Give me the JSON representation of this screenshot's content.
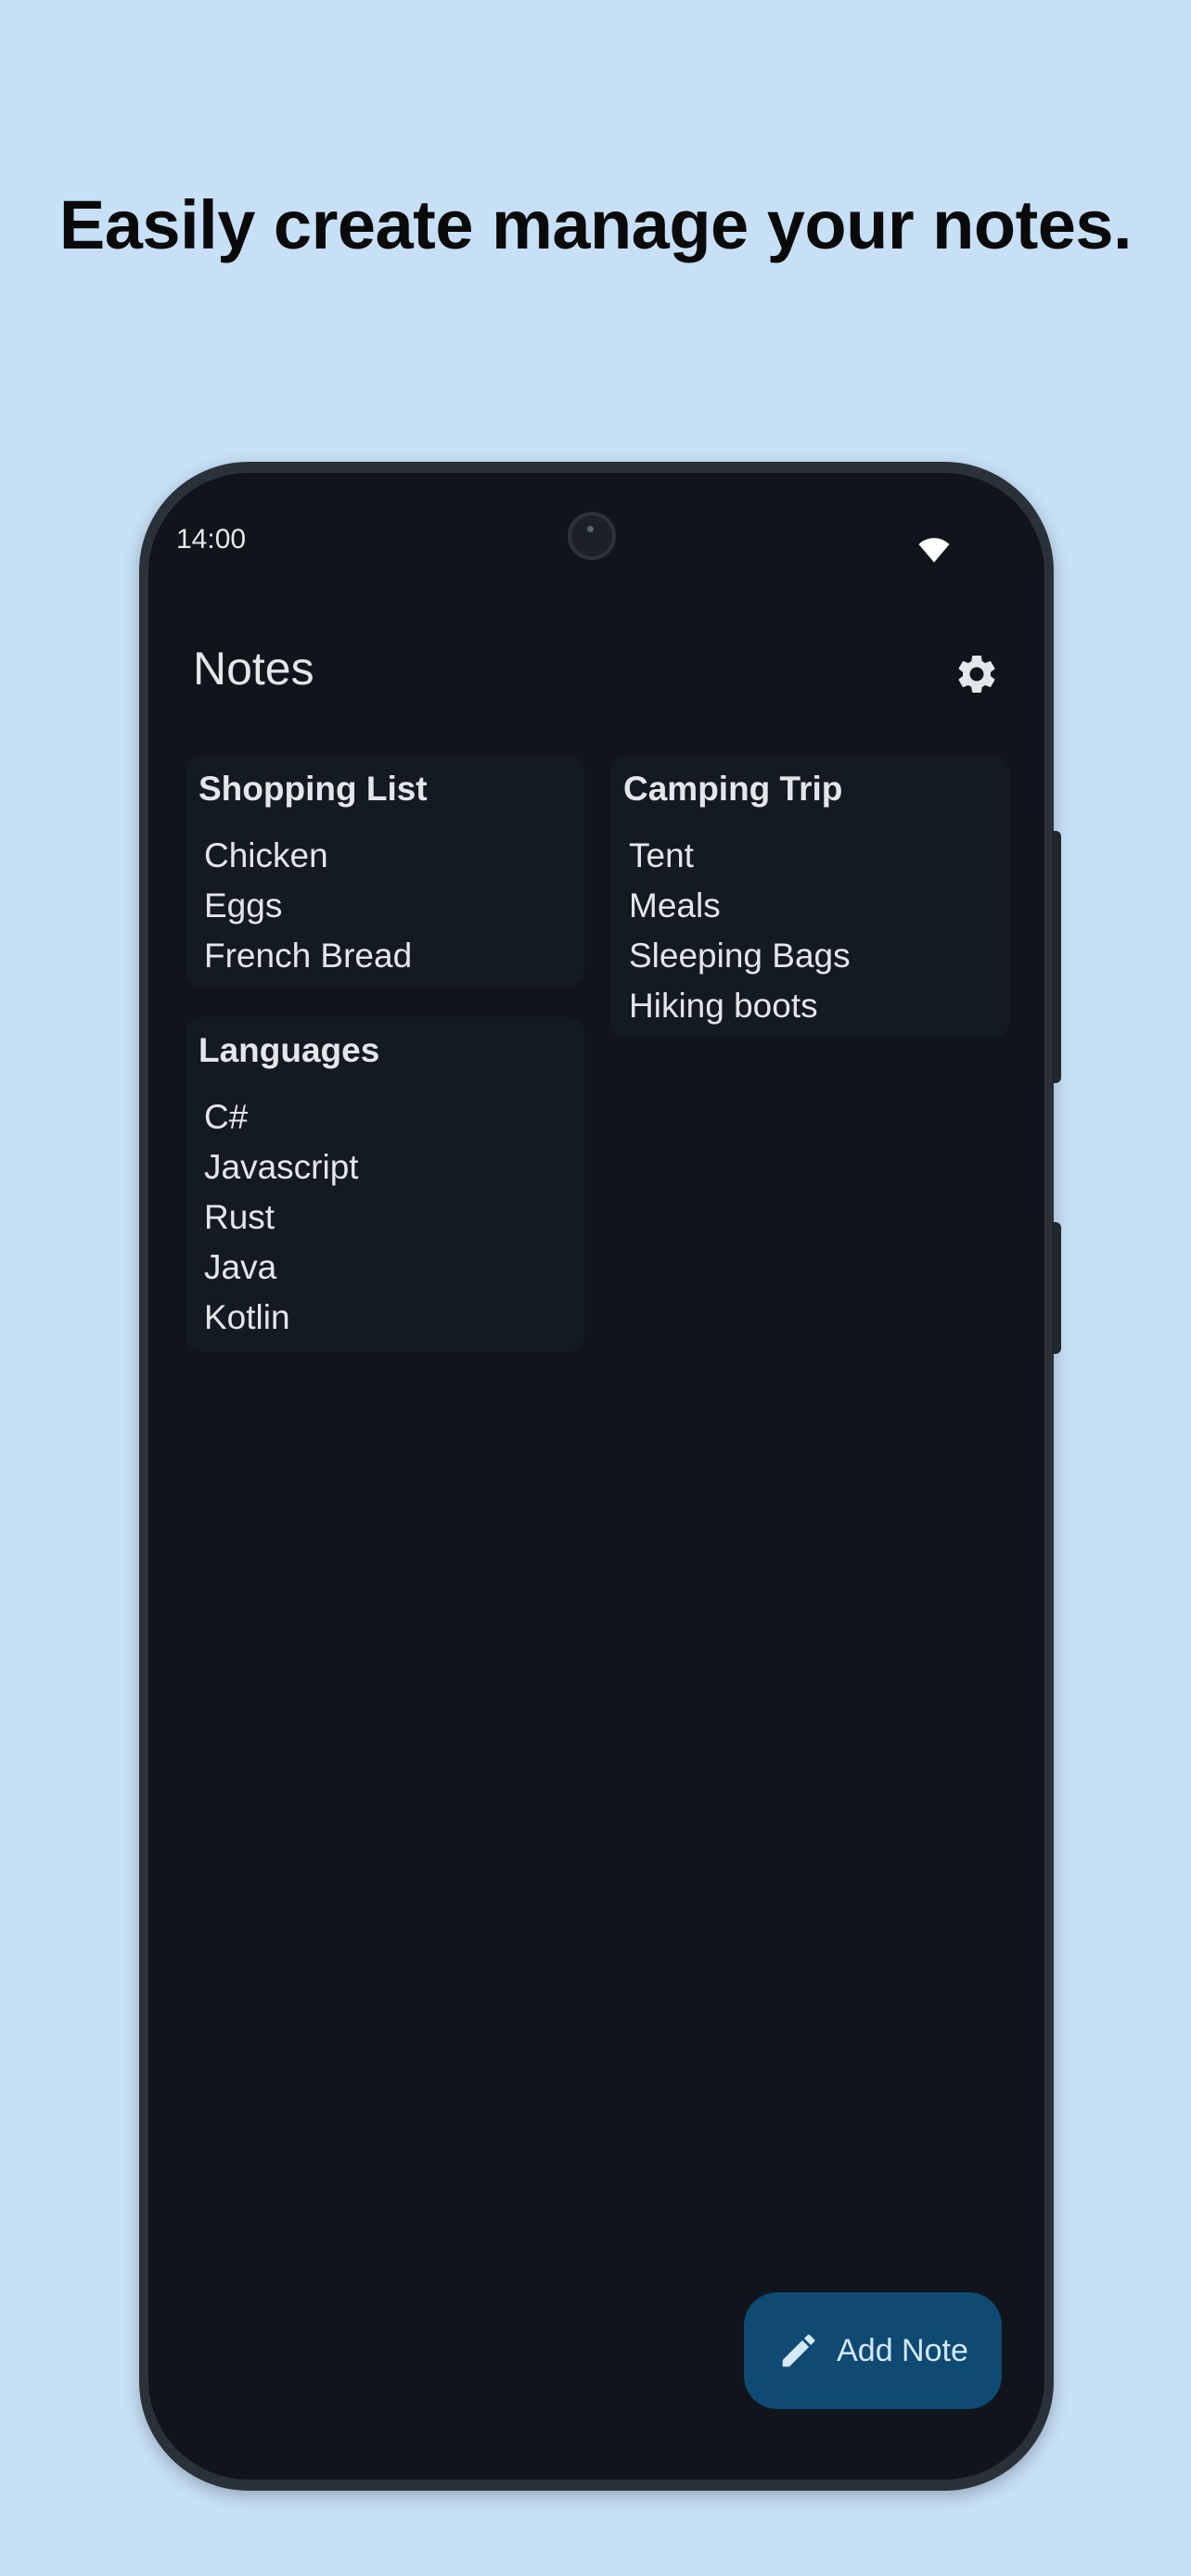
{
  "headline": "Easily create manage your notes.",
  "status_bar": {
    "time": "14:00",
    "icons": [
      "wifi-icon"
    ]
  },
  "app_bar": {
    "title": "Notes",
    "settings_icon": "gear-icon"
  },
  "notes": [
    {
      "title": "Shopping List",
      "lines": [
        "Chicken",
        "Eggs",
        "French Bread"
      ]
    },
    {
      "title": "Camping Trip",
      "lines": [
        "Tent",
        "Meals",
        "Sleeping Bags",
        "Hiking boots"
      ]
    },
    {
      "title": "Languages",
      "lines": [
        "C#",
        "Javascript",
        "Rust",
        "Java",
        "Kotlin"
      ]
    }
  ],
  "fab": {
    "label": "Add Note",
    "icon": "pencil-icon"
  },
  "colors": {
    "background": "#c7e0f7",
    "screen": "#10151c",
    "card": "#141a22",
    "fab": "#0f4a73",
    "fab_text": "#d6e9fb"
  }
}
